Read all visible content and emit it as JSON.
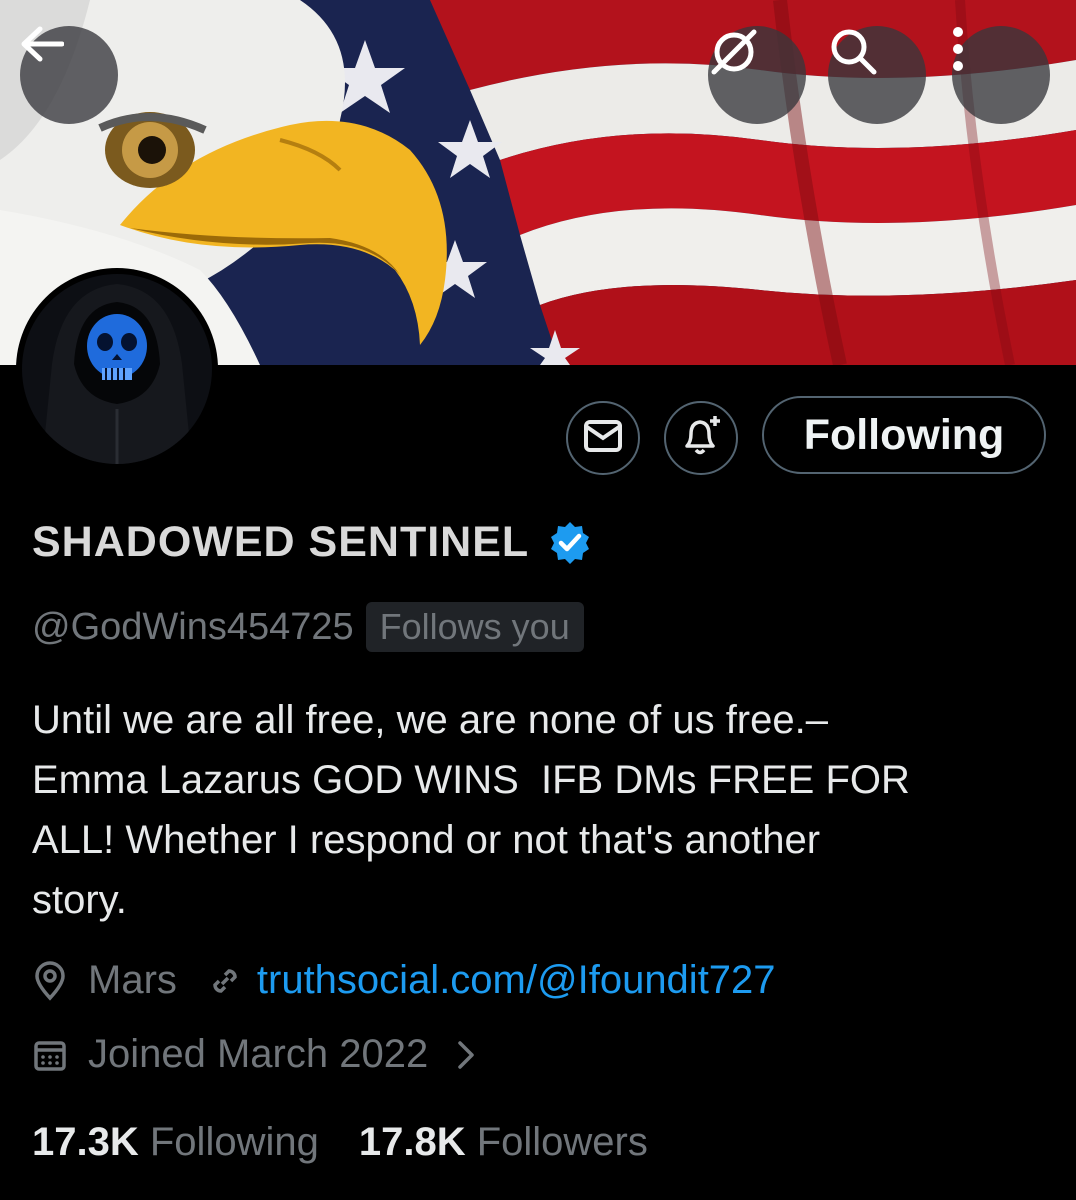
{
  "header": {
    "back_icon": "arrow-left-icon",
    "grok_icon": "grok-icon",
    "search_icon": "search-icon",
    "more_icon": "more-vertical-icon"
  },
  "actions": {
    "message_icon": "envelope-icon",
    "notify_icon": "bell-plus-icon",
    "follow_label": "Following"
  },
  "profile": {
    "display_name": "SHADOWED SENTINEL",
    "verified": true,
    "handle": "@GodWins454725",
    "follows_you_badge": "Follows you",
    "bio_lines": [
      "Until we are all free, we are none of us free.–",
      "Emma Lazarus GOD WINS  IFB DMs FREE FOR",
      "ALL! Whether I respond or not that's another",
      "story."
    ],
    "location": "Mars",
    "website": "truthsocial.com/@Ifoundit727",
    "joined": "Joined March 2022"
  },
  "stats": {
    "following_count": "17.3K",
    "following_label": "Following",
    "followers_count": "17.8K",
    "followers_label": "Followers"
  },
  "colors": {
    "accent": "#1d9bf0",
    "muted": "#71767b",
    "background": "#000000"
  }
}
